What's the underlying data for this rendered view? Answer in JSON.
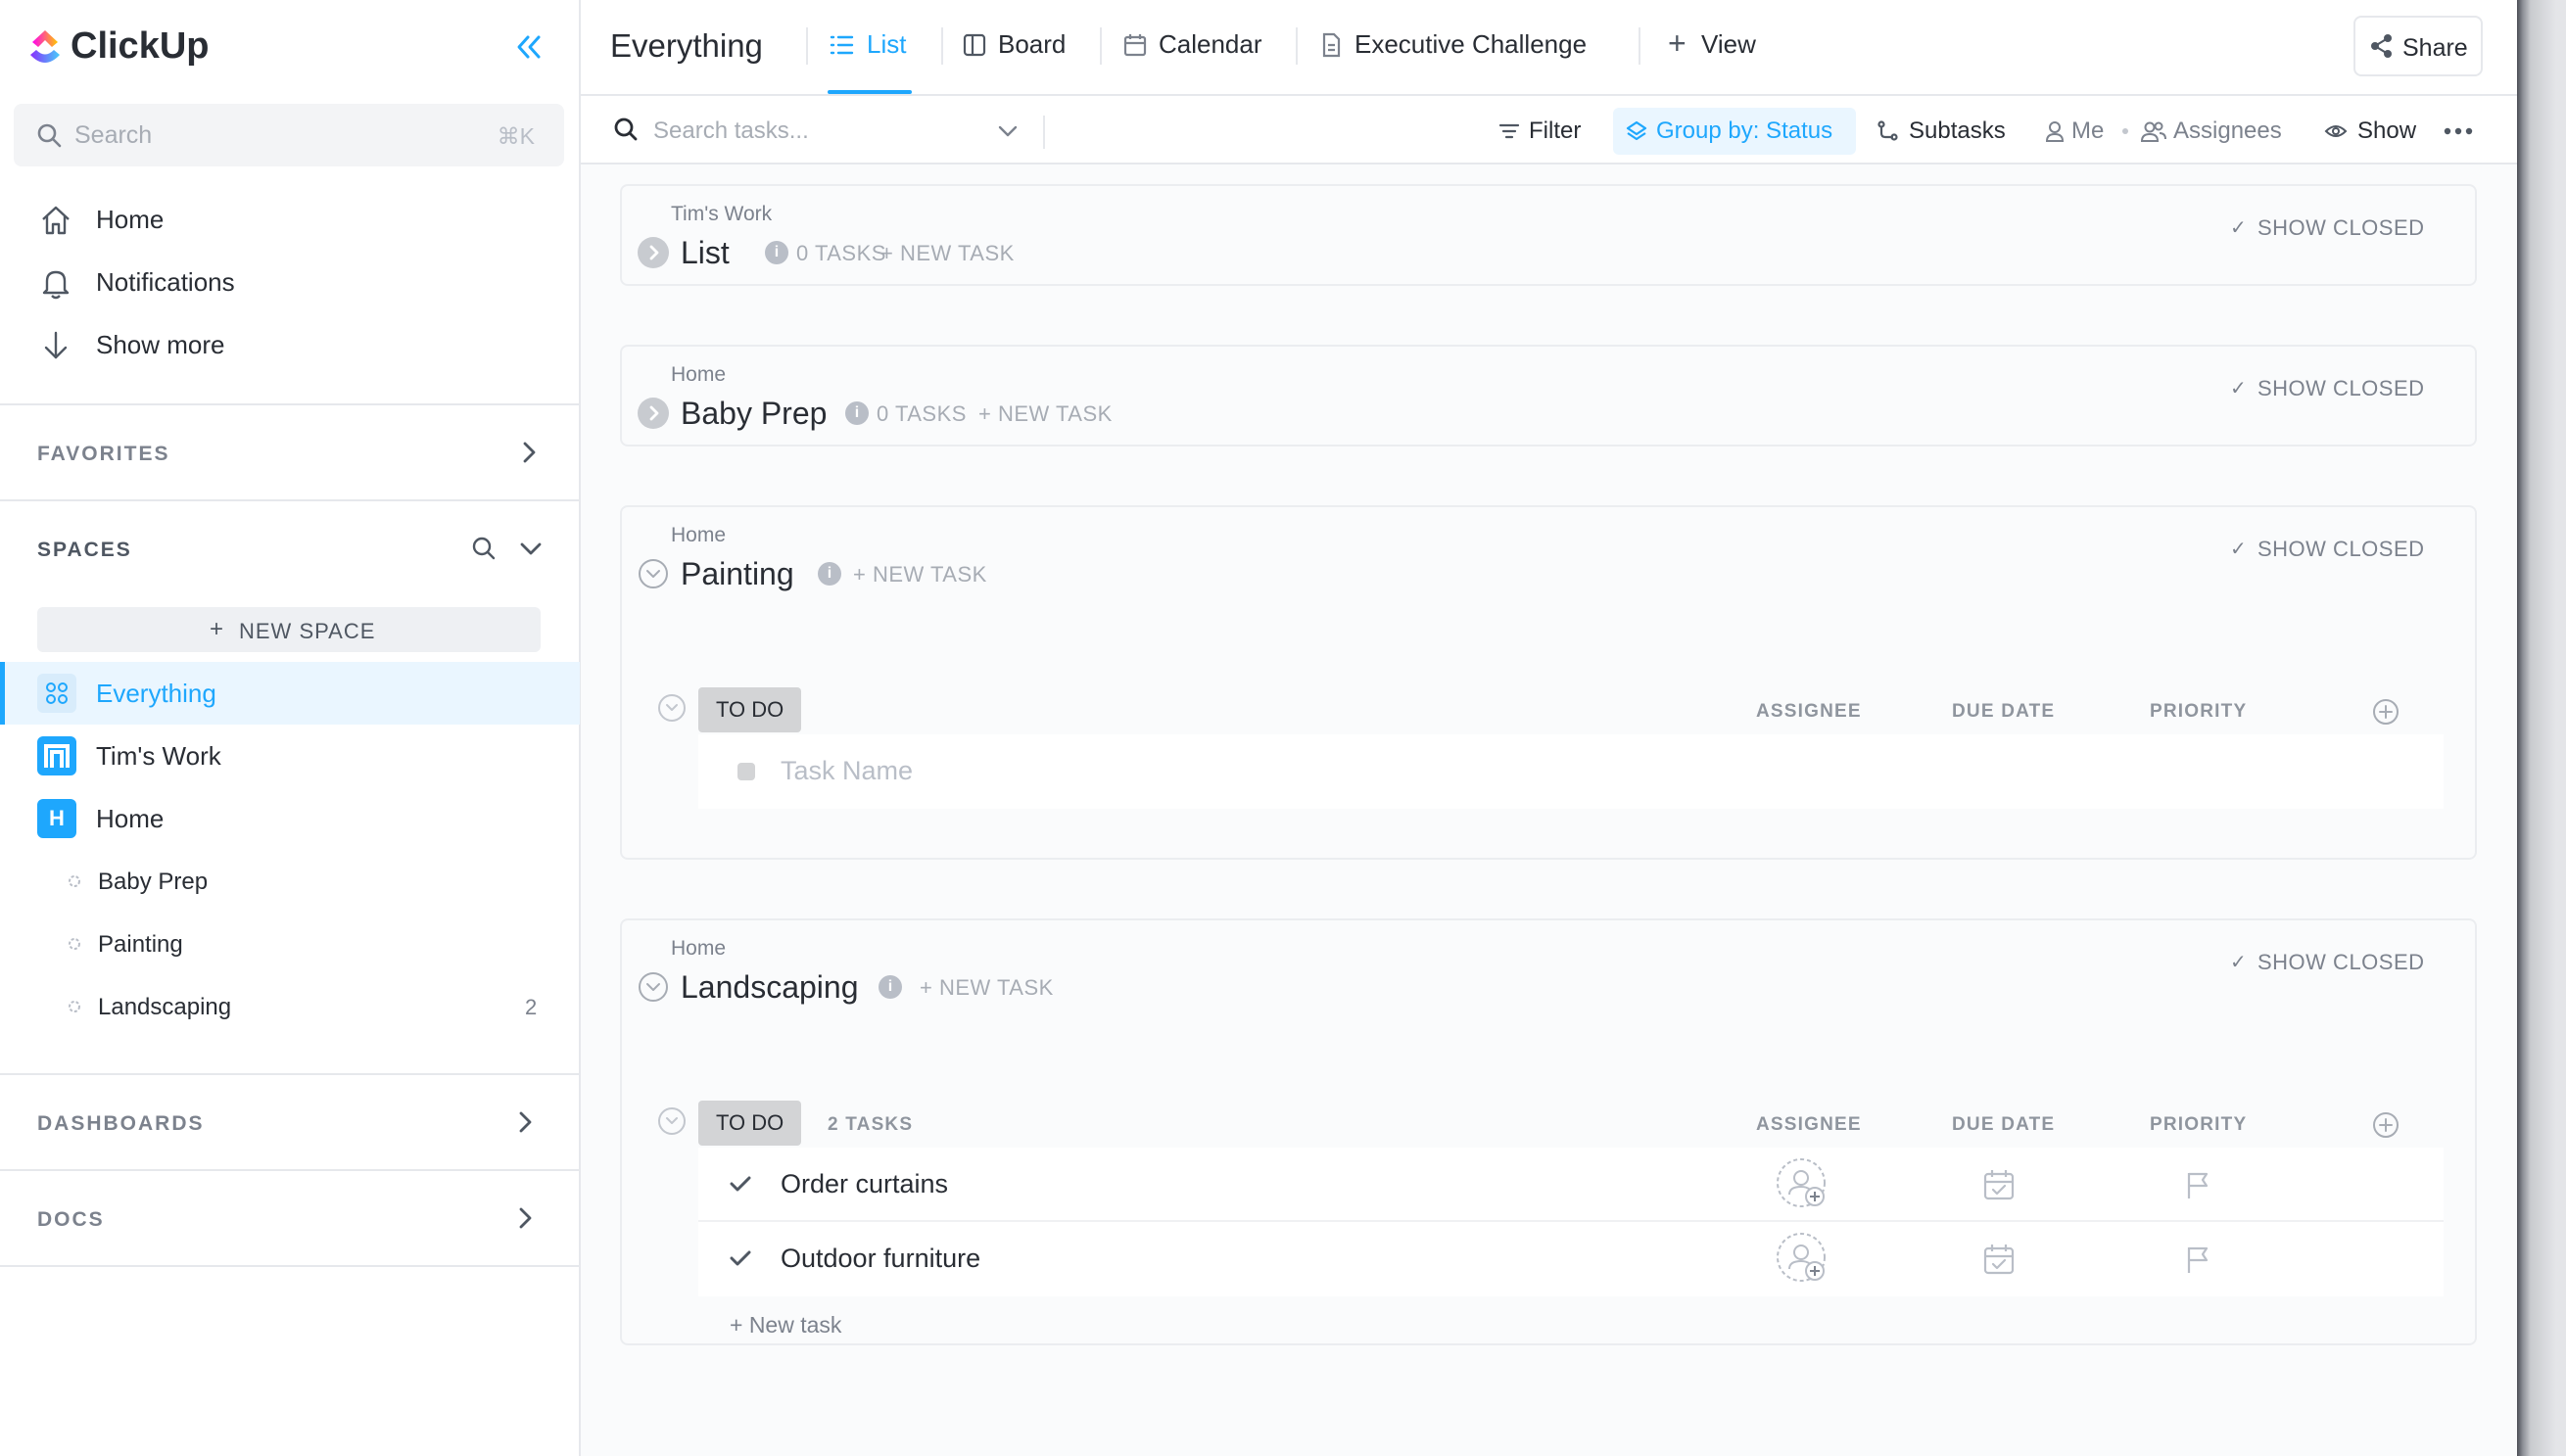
{
  "app": {
    "name": "ClickUp"
  },
  "sidebar": {
    "search": {
      "placeholder": "Search",
      "shortcut": "⌘K"
    },
    "nav": [
      {
        "label": "Home",
        "icon": "home-icon"
      },
      {
        "label": "Notifications",
        "icon": "bell-icon"
      },
      {
        "label": "Show more",
        "icon": "arrow-down-icon"
      }
    ],
    "favorites_label": "FAVORITES",
    "spaces_label": "SPACES",
    "new_space_label": "NEW SPACE",
    "spaces": [
      {
        "label": "Everything",
        "icon": "grid-icon",
        "active": true
      },
      {
        "label": "Tim's Work",
        "icon": "tims-work-space-icon"
      },
      {
        "label": "Home",
        "icon": "home-space-avatar",
        "avatar_letter": "H"
      }
    ],
    "lists": [
      {
        "label": "Baby Prep",
        "count": ""
      },
      {
        "label": "Painting",
        "count": ""
      },
      {
        "label": "Landscaping",
        "count": "2"
      }
    ],
    "dashboards_label": "DASHBOARDS",
    "docs_label": "DOCS"
  },
  "header": {
    "title": "Everything",
    "tabs": [
      {
        "label": "List",
        "icon": "list-icon",
        "active": true
      },
      {
        "label": "Board",
        "icon": "board-icon"
      },
      {
        "label": "Calendar",
        "icon": "calendar-icon"
      },
      {
        "label": "Executive Challenge",
        "icon": "doc-icon"
      },
      {
        "label": "View",
        "icon": "plus-icon"
      }
    ],
    "share_label": "Share"
  },
  "toolbar": {
    "search_placeholder": "Search tasks...",
    "filter_label": "Filter",
    "group_by_label": "Group by: Status",
    "subtasks_label": "Subtasks",
    "me_label": "Me",
    "assignees_label": "Assignees",
    "show_label": "Show"
  },
  "lists": [
    {
      "parent": "Tim's Work",
      "title": "List",
      "task_count": "0 TASKS",
      "new_task": "+ NEW TASK",
      "show_closed": "SHOW CLOSED",
      "expanded": false
    },
    {
      "parent": "Home",
      "title": "Baby Prep",
      "task_count": "0 TASKS",
      "new_task": "+ NEW TASK",
      "show_closed": "SHOW CLOSED",
      "expanded": false
    },
    {
      "parent": "Home",
      "title": "Painting",
      "new_task": "+ NEW TASK",
      "show_closed": "SHOW CLOSED",
      "expanded": true,
      "group": {
        "status": "TO DO",
        "count": "",
        "columns": [
          "ASSIGNEE",
          "DUE DATE",
          "PRIORITY"
        ],
        "task_placeholder": "Task Name"
      }
    },
    {
      "parent": "Home",
      "title": "Landscaping",
      "new_task": "+ NEW TASK",
      "show_closed": "SHOW CLOSED",
      "expanded": true,
      "group": {
        "status": "TO DO",
        "count": "2 TASKS",
        "columns": [
          "ASSIGNEE",
          "DUE DATE",
          "PRIORITY"
        ],
        "tasks": [
          "Order curtains",
          "Outdoor furniture"
        ],
        "new_task_link": "+ New task"
      }
    }
  ],
  "colors": {
    "accent": "#1ea7fd",
    "brand_purple": "#7b68ee",
    "brand_pink": "#fd71af",
    "status_todo": "#d3d4d6"
  }
}
